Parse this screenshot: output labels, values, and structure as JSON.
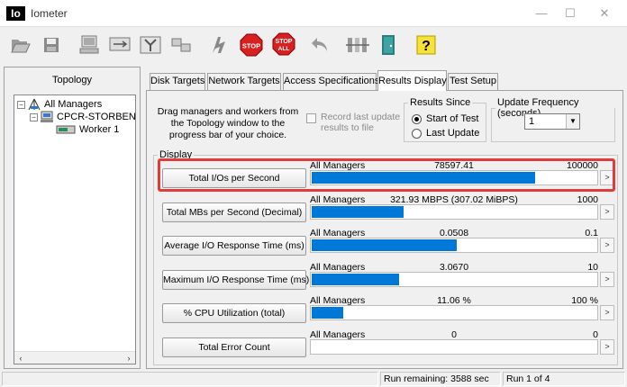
{
  "window": {
    "logo_text": "Io",
    "title": "Iometer",
    "controls": {
      "minimize": "—",
      "maximize": "☐",
      "close": "✕"
    }
  },
  "toolbar": {
    "buttons": [
      {
        "name": "open-config-button",
        "icon": "folder-open-icon"
      },
      {
        "name": "save-config-button",
        "icon": "floppy-disk-icon"
      },
      {
        "name": "new-disk-worker-button",
        "icon": "computer-icon"
      },
      {
        "name": "new-network-worker-button",
        "icon": "network-worker-icon"
      },
      {
        "name": "duplicate-worker-button",
        "icon": "fork-icon"
      },
      {
        "name": "disconnect-button",
        "icon": "network-icon"
      },
      {
        "name": "start-tests-button",
        "icon": "flag-icon"
      },
      {
        "name": "stop-button",
        "icon": "stop-sign-icon",
        "label": "STOP"
      },
      {
        "name": "stop-all-button",
        "icon": "stop-all-icon",
        "label": "STOP",
        "sublabel": "ALL"
      },
      {
        "name": "reset-workers-button",
        "icon": "undo-arrow-icon"
      },
      {
        "name": "reset-managers-button",
        "icon": "managers-icon"
      },
      {
        "name": "exit-button",
        "icon": "exit-door-icon"
      },
      {
        "name": "about-button",
        "icon": "help-icon",
        "label": "?"
      }
    ]
  },
  "topology": {
    "title": "Topology",
    "tree": [
      {
        "label": "All Managers",
        "expander": "−",
        "icon": "managers-icon",
        "level": 0
      },
      {
        "label": "CPCR-STORBENC",
        "expander": "−",
        "icon": "computer-icon",
        "level": 1
      },
      {
        "label": "Worker 1",
        "icon": "disk-worker-icon",
        "level": 2
      }
    ],
    "scroll_left": "‹",
    "scroll_right": "›"
  },
  "tabs": [
    {
      "label": "Disk Targets",
      "active": false
    },
    {
      "label": "Network Targets",
      "active": false
    },
    {
      "label": "Access Specifications",
      "active": false
    },
    {
      "label": "Results Display",
      "active": true
    },
    {
      "label": "Test Setup",
      "active": false
    }
  ],
  "results": {
    "instructions": "Drag managers and workers from the Topology window to the progress bar of your choice.",
    "record_label": "Record last update results to file",
    "record_checked": false,
    "results_since": {
      "title": "Results Since",
      "options": [
        {
          "label": "Start of Test",
          "selected": true
        },
        {
          "label": "Last Update",
          "selected": false
        }
      ]
    },
    "update_frequency": {
      "title": "Update Frequency (seconds)",
      "value": "1",
      "dropdown_arrow": "▼"
    },
    "display_title": "Display",
    "arrow_glyph": ">",
    "metrics": [
      {
        "button": "Total I/Os per Second",
        "target": "All Managers",
        "value": "78597.41",
        "max": "100000",
        "fill": 0.786,
        "highlighted": true
      },
      {
        "button": "Total MBs per Second (Decimal)",
        "target": "All Managers",
        "value": "321.93 MBPS (307.02 MiBPS)",
        "max": "1000",
        "fill": 0.322
      },
      {
        "button": "Average I/O Response Time (ms)",
        "target": "All Managers",
        "value": "0.0508",
        "max": "0.1",
        "fill": 0.508
      },
      {
        "button": "Maximum I/O Response Time (ms)",
        "target": "All Managers",
        "value": "3.0670",
        "max": "10",
        "fill": 0.307
      },
      {
        "button": "% CPU Utilization (total)",
        "target": "All Managers",
        "value": "11.06 %",
        "max": "100 %",
        "fill": 0.1106
      },
      {
        "button": "Total Error Count",
        "target": "All Managers",
        "value": "0",
        "max": "0",
        "fill": 0
      }
    ]
  },
  "status": {
    "run_remaining": "Run remaining: 3588 sec",
    "run_count": "Run 1 of 4"
  },
  "colors": {
    "bar_fill": "#0078d7",
    "highlight": "#e03c3c",
    "stop_red": "#d92020"
  }
}
